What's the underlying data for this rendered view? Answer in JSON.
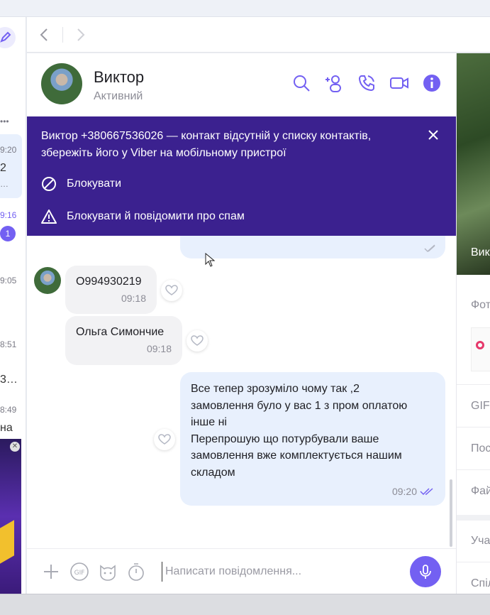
{
  "left": {
    "times": [
      "9:20",
      "9:16",
      "9:05",
      "8:51",
      "8:49"
    ],
    "snips": [
      "2",
      "…",
      "3…",
      "на"
    ],
    "badge": "1",
    "more": "•••",
    "ad_close": "✕"
  },
  "contact": {
    "name": "Виктор",
    "status": "Активний"
  },
  "banner": {
    "message": "Виктор +380667536026 — контакт відсутній у списку контактів, збережіть його у Viber на мобільному пристрої",
    "block_label": "Блокувати",
    "block_report_label": "Блокувати й повідомити про спам"
  },
  "messages": {
    "incoming": [
      {
        "text": "О994930219",
        "time": "09:18"
      },
      {
        "text": "Ольга Симончие",
        "time": "09:18"
      }
    ],
    "outgoing": {
      "lines": [
        "Все тепер зрозуміло чому так ,2",
        "замовлення було у вас 1 з пром оплатою",
        "інше ні",
        "Перепрошую що потурбували ваше",
        "замовлення вже комплектується нашим",
        "складом"
      ],
      "time": "09:20"
    }
  },
  "composer": {
    "placeholder": "Написати повідомлення..."
  },
  "right": {
    "caption": "Вик",
    "labels": [
      "Фот",
      "GIF",
      "Пос",
      "Фай",
      "Уча",
      "Спіл"
    ]
  },
  "colors": {
    "accent": "#7360f2",
    "banner": "#3b218f",
    "outgoing_bubble": "#e8f0fd",
    "incoming_bubble": "#f2f2f4"
  }
}
